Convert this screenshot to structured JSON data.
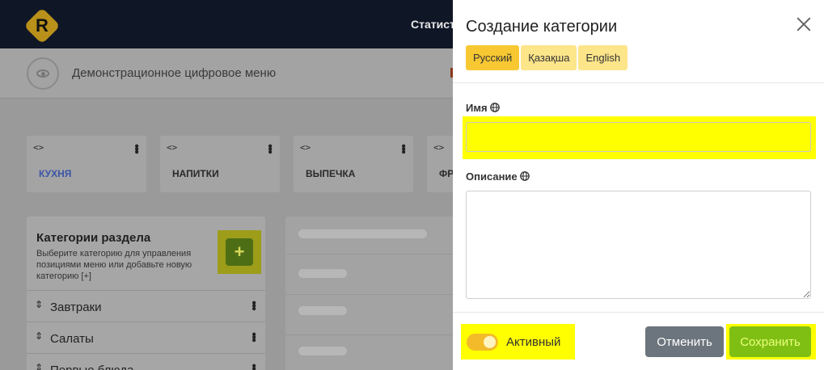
{
  "app": {
    "logo_letter": "R",
    "top_nav_partial": "Статист",
    "menu_name": "Демонстрационное цифровое меню"
  },
  "sections": [
    {
      "code": "<>",
      "label": "КУХНЯ",
      "active": true
    },
    {
      "code": "<>",
      "label": "НАПИТКИ"
    },
    {
      "code": "<>",
      "label": "ВЫПЕЧКА"
    },
    {
      "code": "<>",
      "label": "ФР"
    }
  ],
  "categories_panel": {
    "title": "Категории раздела",
    "description": "Выберите категорию для управления позициями меню или добавьте новую категорию [+]",
    "add_label": "+",
    "items": [
      {
        "name": "Завтраки"
      },
      {
        "name": "Салаты"
      },
      {
        "name": "Первые блюда"
      }
    ]
  },
  "modal": {
    "title": "Создание категории",
    "languages": [
      {
        "label": "Русский",
        "active": true
      },
      {
        "label": "Қазақша",
        "active": false
      },
      {
        "label": "English",
        "active": false
      }
    ],
    "name_label": "Имя",
    "name_value": "",
    "description_label": "Описание",
    "description_value": "",
    "active_toggle_label": "Активный",
    "active_toggle_on": true,
    "cancel_label": "Отменить",
    "save_label": "Сохранить"
  },
  "colors": {
    "accent_yellow": "#f7c832",
    "lang_tab_inactive": "#fde58a",
    "highlight": "#ffff00",
    "save_green": "#7fbf14",
    "cancel_gray": "#6c757d",
    "topbar": "#0f1726"
  },
  "icons": {
    "close": "close-icon",
    "globe": "globe-icon",
    "eye": "eye-icon",
    "sort": "sort-arrows-icon",
    "kebab": "kebab-menu-icon",
    "code": "code-brackets-icon"
  }
}
